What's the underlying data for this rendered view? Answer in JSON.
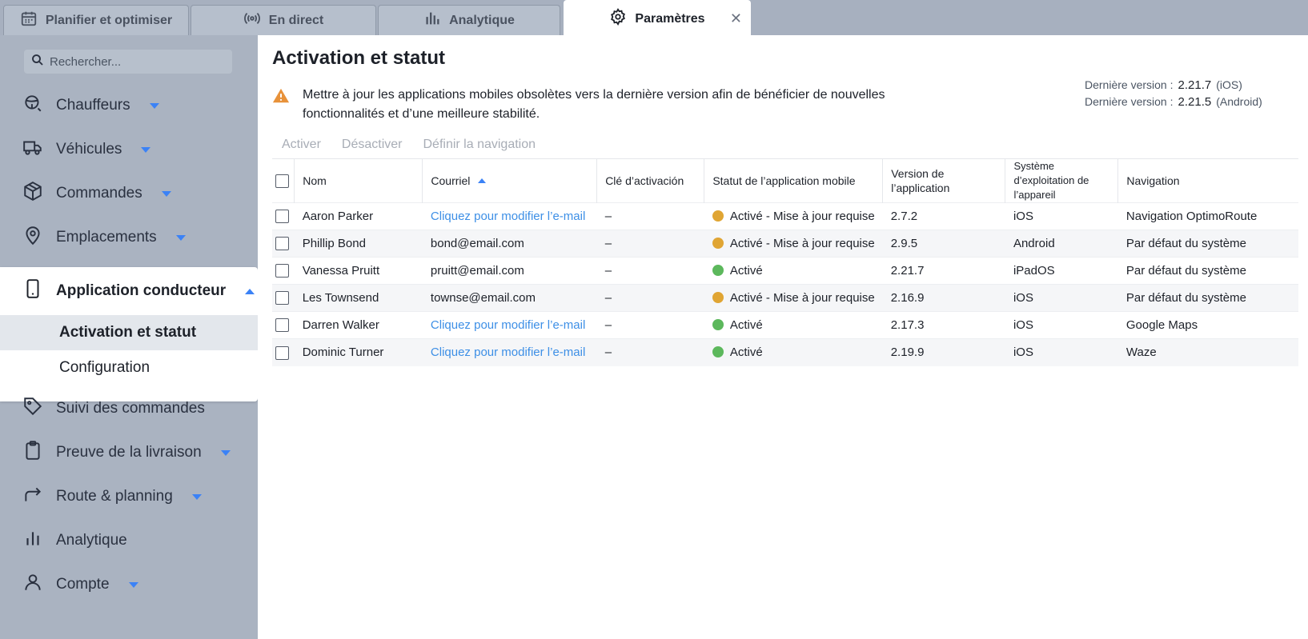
{
  "tabs": [
    {
      "label": "Planifier et optimiser",
      "icon": "calendar-icon"
    },
    {
      "label": "En direct",
      "icon": "broadcast-icon"
    },
    {
      "label": "Analytique",
      "icon": "bar-chart-icon"
    },
    {
      "label": "Paramètres",
      "icon": "gear-icon",
      "active": true
    }
  ],
  "search": {
    "placeholder": "Rechercher..."
  },
  "sidebar": {
    "items": [
      {
        "label": "Chauffeurs",
        "icon": "driver-icon"
      },
      {
        "label": "Véhicules",
        "icon": "truck-icon"
      },
      {
        "label": "Commandes",
        "icon": "box-icon"
      },
      {
        "label": "Emplacements",
        "icon": "location-pin-icon"
      },
      {
        "label": "Application conducteur",
        "icon": "mobile-phone-icon",
        "expanded": true
      },
      {
        "label": "Suivi des commandes",
        "icon": "tag-icon"
      },
      {
        "label": "Preuve de la livraison",
        "icon": "clipboard-icon"
      },
      {
        "label": "Route & planning",
        "icon": "route-arrow-icon"
      },
      {
        "label": "Analytique",
        "icon": "bar-chart-icon"
      },
      {
        "label": "Compte",
        "icon": "user-icon"
      }
    ],
    "subitems": [
      {
        "label": "Activation et statut",
        "active": true
      },
      {
        "label": "Configuration"
      }
    ]
  },
  "main": {
    "title": "Activation et statut",
    "notice": "Mettre à jour les applications mobiles obsolètes vers la dernière version afin de bénéficier de nouvelles fonctionnalités et d’une meilleure stabilité.",
    "versions": [
      {
        "label": "Dernière version :",
        "value": "2.21.7",
        "platform": "(iOS)"
      },
      {
        "label": "Dernière version :",
        "value": "2.21.5",
        "platform": "(Android)"
      }
    ],
    "actions": [
      "Activer",
      "Désactiver",
      "Définir la navigation"
    ]
  },
  "table": {
    "headers": [
      "Nom",
      "Courriel",
      "Clé d’activación",
      "Statut de l’application mobile",
      "Version de l’application",
      "Système d’exploitation de l’appareil",
      "Navigation"
    ],
    "rows": [
      {
        "name": "Aaron Parker",
        "email": "Cliquez pour modifier l’e-mail",
        "email_link": true,
        "key": "–",
        "status": "Activé - Mise à jour requise",
        "status_color": "#e0a533",
        "version": "2.7.2",
        "os": "iOS",
        "nav": "Navigation OptimoRoute"
      },
      {
        "name": "Phillip Bond",
        "email": "bond@email.com",
        "email_link": false,
        "key": "–",
        "status": "Activé - Mise à jour requise",
        "status_color": "#e0a533",
        "version": "2.9.5",
        "os": "Android",
        "nav": "Par défaut du système"
      },
      {
        "name": "Vanessa Pruitt",
        "email": "pruitt@email.com",
        "email_link": false,
        "key": "–",
        "status": "Activé",
        "status_color": "#5cb85c",
        "version": "2.21.7",
        "os": "iPadOS",
        "nav": "Par défaut du système"
      },
      {
        "name": "Les Townsend",
        "email": "townse@email.com",
        "email_link": false,
        "key": "–",
        "status": "Activé - Mise à jour requise",
        "status_color": "#e0a533",
        "version": "2.16.9",
        "os": "iOS",
        "nav": "Par défaut du système"
      },
      {
        "name": "Darren Walker",
        "email": "Cliquez pour modifier l’e-mail",
        "email_link": true,
        "key": "–",
        "status": "Activé",
        "status_color": "#5cb85c",
        "version": "2.17.3",
        "os": "iOS",
        "nav": "Google Maps"
      },
      {
        "name": "Dominic Turner",
        "email": "Cliquez pour modifier l’e-mail",
        "email_link": true,
        "key": "–",
        "status": "Activé",
        "status_color": "#5cb85c",
        "version": "2.19.9",
        "os": "iOS",
        "nav": "Waze"
      }
    ]
  },
  "colors": {
    "accent": "#3b82f6",
    "link": "#3d8fe6",
    "warning": "#e8923a"
  }
}
